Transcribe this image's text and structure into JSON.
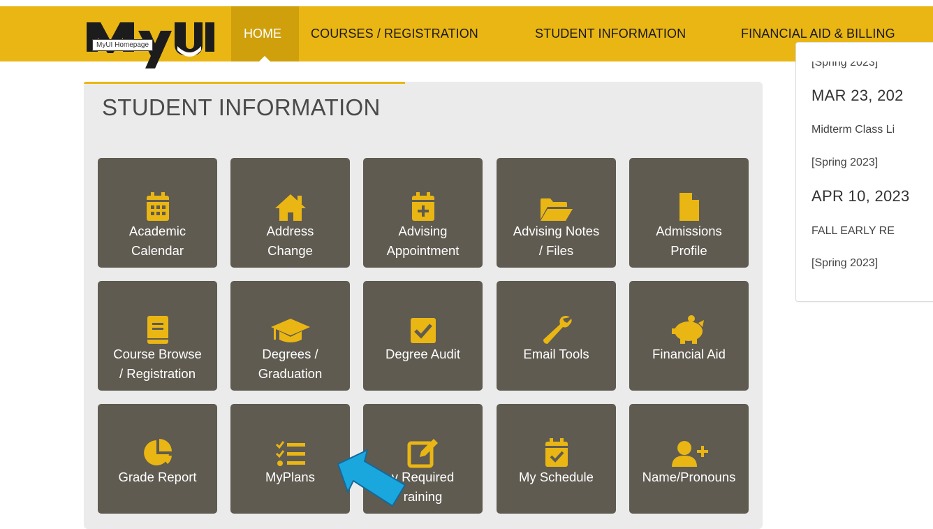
{
  "header": {
    "logo_text": "MyUI",
    "logo_tooltip": "MyUI Homepage",
    "nav": {
      "home": "HOME",
      "courses": "COURSES / REGISTRATION",
      "student_info": "STUDENT INFORMATION",
      "financial": "FINANCIAL AID & BILLING"
    },
    "brand_color": "#eab613"
  },
  "panel": {
    "title": "STUDENT INFORMATION",
    "tiles": [
      {
        "line1": "Academic",
        "line2": "Calendar",
        "icon": "calendar-grid-icon"
      },
      {
        "line1": "Address",
        "line2": "Change",
        "icon": "home-icon"
      },
      {
        "line1": "Advising",
        "line2": "Appointment",
        "icon": "calendar-plus-icon"
      },
      {
        "line1": "Advising Notes",
        "line2": "/ Files",
        "icon": "folder-open-icon"
      },
      {
        "line1": "Admissions",
        "line2": "Profile",
        "icon": "file-icon"
      },
      {
        "line1": "Course Browse",
        "line2": "/ Registration",
        "icon": "book-icon"
      },
      {
        "line1": "Degrees /",
        "line2": "Graduation",
        "icon": "graduation-cap-icon"
      },
      {
        "line1": "Degree Audit",
        "line2": "",
        "icon": "checkbox-icon"
      },
      {
        "line1": "Email Tools",
        "line2": "",
        "icon": "wrench-icon"
      },
      {
        "line1": "Financial Aid",
        "line2": "",
        "icon": "piggy-bank-icon"
      },
      {
        "line1": "Grade Report",
        "line2": "",
        "icon": "pie-chart-icon"
      },
      {
        "line1": "MyPlans",
        "line2": "",
        "icon": "task-list-icon"
      },
      {
        "line1": "y Required",
        "line2": "raining",
        "icon": "edit-icon"
      },
      {
        "line1": "My Schedule",
        "line2": "",
        "icon": "calendar-check-icon"
      },
      {
        "line1": "Name/Pronouns",
        "line2": "",
        "icon": "user-plus-icon"
      }
    ]
  },
  "sidebar": {
    "top_term": "[Spring 2023]",
    "events": [
      {
        "date": "MAR 23, 202",
        "title": "Midterm Class Li",
        "term": "[Spring 2023]"
      },
      {
        "date": "APR 10, 2023",
        "title": "FALL EARLY RE",
        "term": "[Spring 2023]"
      }
    ]
  },
  "icon_color": "#eab613"
}
